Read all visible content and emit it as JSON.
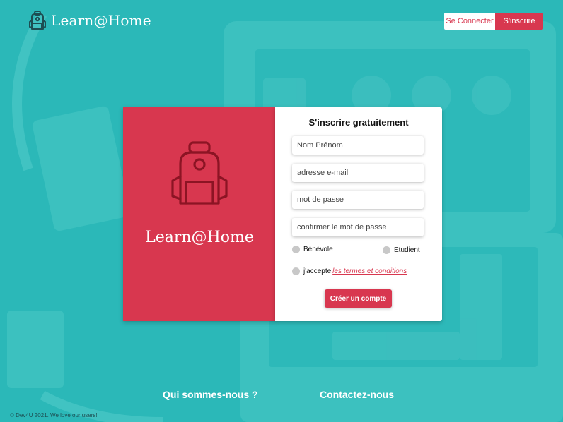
{
  "header": {
    "brand": "Learn@Home",
    "login_label": "Se Connecter",
    "signup_label": "S'inscrire"
  },
  "card": {
    "brand": "Learn@Home",
    "title": "S'inscrire gratuitement",
    "fields": {
      "name_placeholder": "Nom Prénom",
      "email_placeholder": "adresse e-mail",
      "password_placeholder": "mot de passe",
      "confirm_placeholder": "confirmer le mot de passe"
    },
    "roles": {
      "volunteer": "Bénévole",
      "student": "Etudient"
    },
    "terms": {
      "prefix": "j'accepte",
      "link": "les termes et conditions"
    },
    "submit_label": "Créer un compte"
  },
  "footer": {
    "about": "Qui sommes-nous ?",
    "contact": "Contactez-nous",
    "copyright": "© Dev4U 2021. We love our users!"
  },
  "colors": {
    "background": "#2bb8b8",
    "accent": "#d8374f"
  },
  "icons": {
    "brand": "backpack-icon",
    "card": "backpack-icon"
  }
}
